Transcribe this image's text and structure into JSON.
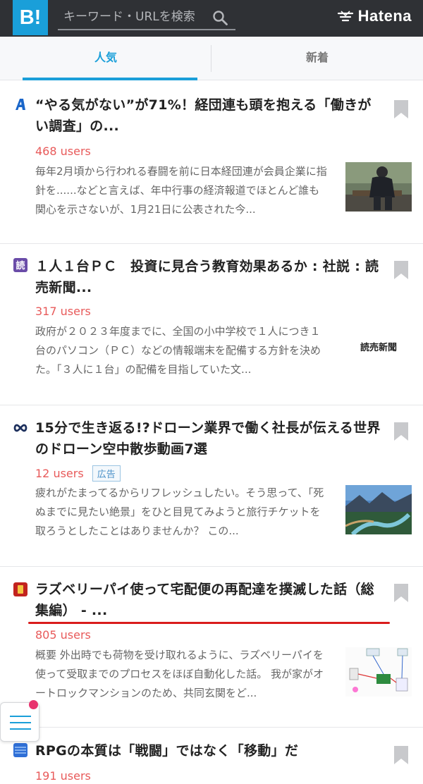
{
  "header": {
    "logo_text": "B!",
    "search_placeholder": "キーワード・URLを検索",
    "brand": "Hatena"
  },
  "tabs": [
    {
      "label": "人気",
      "active": true
    },
    {
      "label": "新着",
      "active": false
    }
  ],
  "entries": [
    {
      "favicon": "a-blue-icon",
      "title": "“やる気がない”が71%！経団連も頭を抱える「働きがい調査」の...",
      "users": "468 users",
      "description": "毎年2月頃から行われる春闘を前に日本経団連が会員企業に指針を......などと言えば、年中行事の経済報道でほとんど誰も関心を示さないが、1月21日に公表された今...",
      "thumbnail": "photo-man-on-bench"
    },
    {
      "favicon": "yomiuri-icon",
      "title": "１人１台ＰＣ　投資に見合う教育効果あるか : 社説 : 読売新聞...",
      "users": "317 users",
      "description": "政府が２０２３年度までに、全国の小中学校で１人につき１台のパソコン（ＰＣ）などの情報端末を配備する方針を決めた。「３人に１台」の配備を目指していた文...",
      "thumbnail_text": "読売新聞"
    },
    {
      "favicon": "infinity-icon",
      "title": "15分で生き返る!?ドローン業界で働く社長が伝える世界のドローン空中散歩動画7選",
      "users": "12 users",
      "ad_label": "広告",
      "description": "疲れがたまってるからリフレッシュしたい。そう思って、「死ぬまでに見たい絶景」をひと目見てみようと旅行チケットを取ろうとしたことはありませんか？ この...",
      "thumbnail": "photo-river-landscape"
    },
    {
      "favicon": "red-square-icon",
      "title": "ラズベリーパイ使って宅配便の再配達を撲滅した話（総集編） - ...",
      "users": "805 users",
      "description": "概要 外出時でも荷物を受け取れるように、ラズベリーパイを使って受取までのプロセスをほぼ自動化した話。 我が家がオートロックマンションのため、共同玄関をど...",
      "thumbnail": "diagram-raspberry-pi"
    },
    {
      "favicon": "blue-pattern-icon",
      "title": "RPGの本質は「戦闘」ではなく「移動」だ",
      "users": "191 users"
    }
  ],
  "colors": {
    "header_bg": "#2f3135",
    "accent": "#1a9fd9",
    "users": "#e85a5a",
    "underline": "#d91c1c",
    "notification_dot": "#e8336e"
  }
}
